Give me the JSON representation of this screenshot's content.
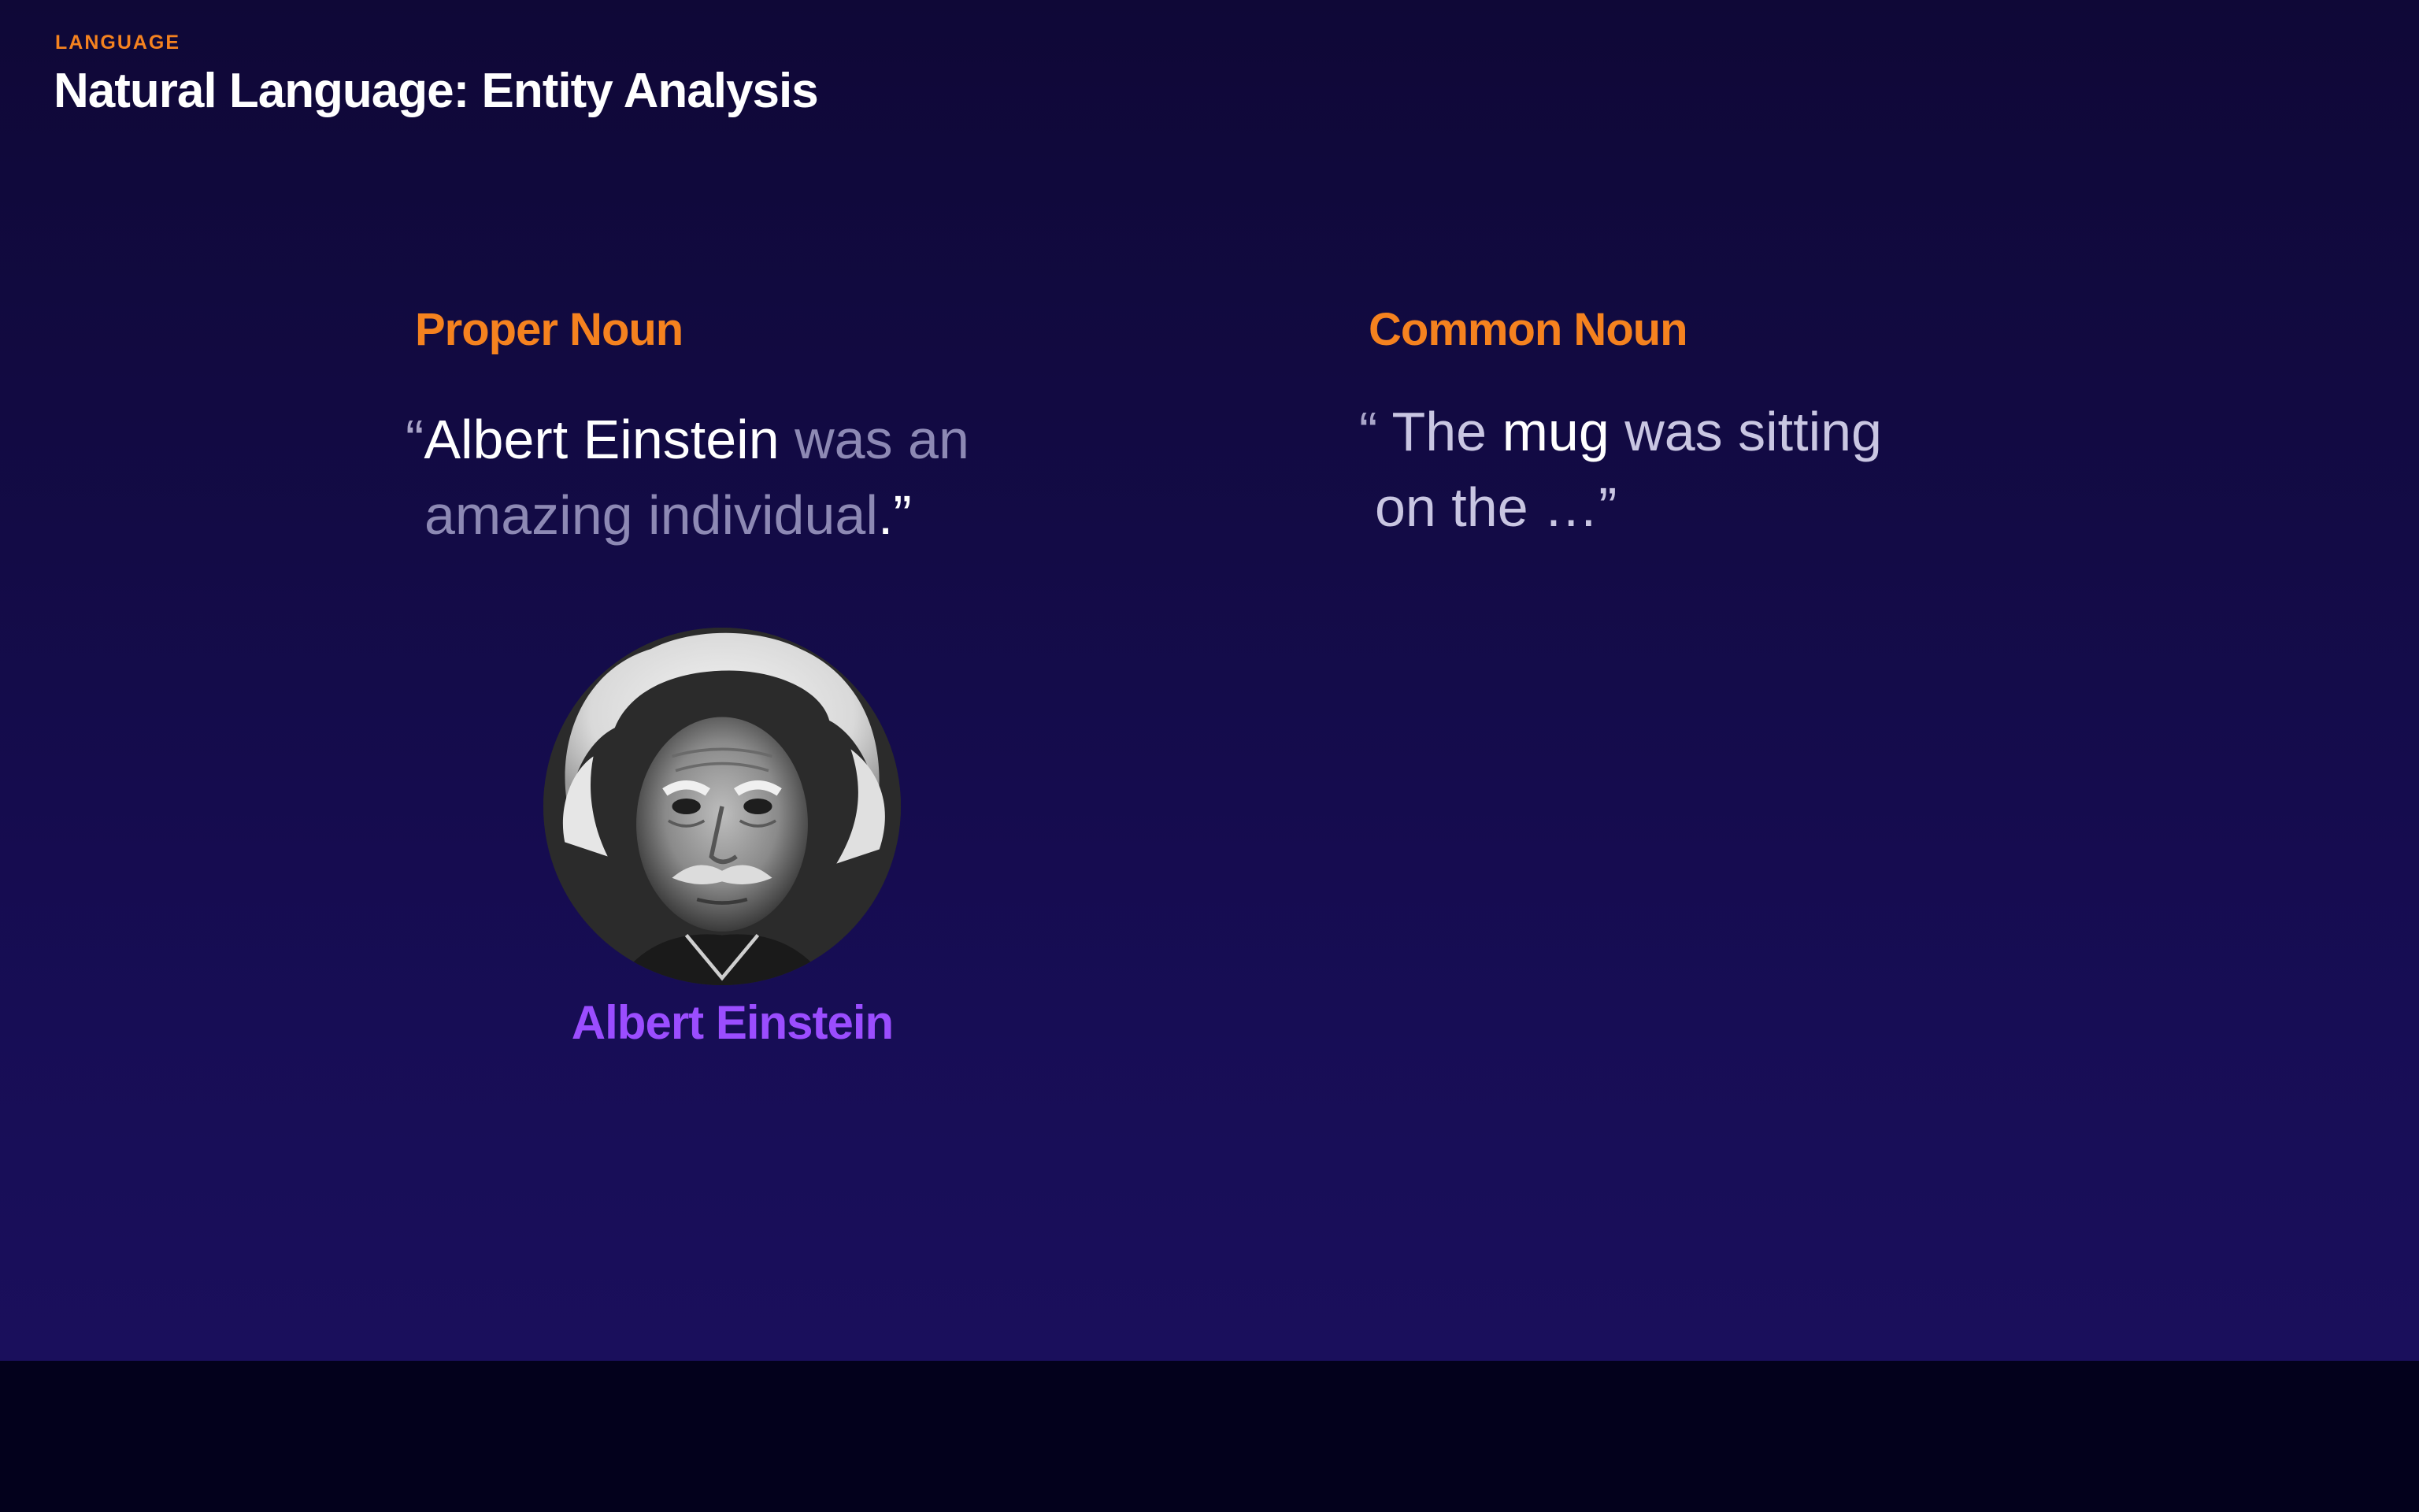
{
  "header": {
    "eyebrow": "LANGUAGE",
    "title": "Natural Language: Entity Analysis"
  },
  "columns": [
    {
      "heading": "Proper Noun",
      "quote": {
        "open_mark": "“",
        "highlight": "Albert Einstein",
        "rest_line1": " was an",
        "line2_text": "amazing individual",
        "close_mark": ".”"
      },
      "entity": {
        "image_icon": "portrait-icon",
        "label": "Albert Einstein"
      }
    },
    {
      "heading": "Common Noun",
      "quote": {
        "open_mark": "“",
        "pre": " The ",
        "highlight": "mug",
        "rest_line1": " was sitting",
        "line2_text": "on the …”"
      }
    }
  ],
  "colors": {
    "accent_orange": "#f5821f",
    "entity_purple": "#9b4dff",
    "text_white": "#ffffff",
    "text_muted": "#8d89b4",
    "background_top": "#0f0837",
    "background_bottom": "#1a0f5c"
  }
}
